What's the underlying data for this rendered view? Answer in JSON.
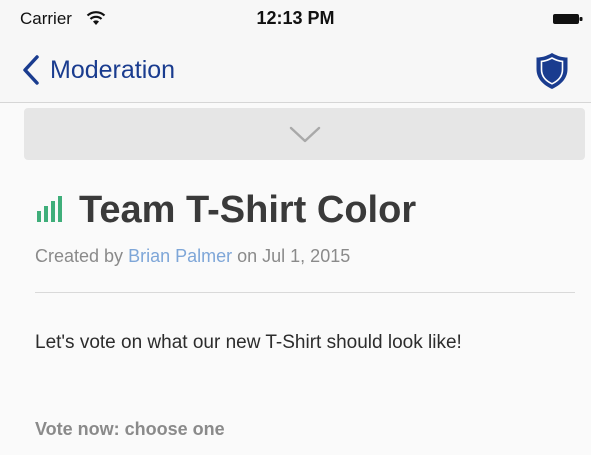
{
  "status_bar": {
    "carrier": "Carrier",
    "time": "12:13 PM",
    "wifi_icon": "wifi-icon",
    "battery_icon": "battery-icon"
  },
  "nav": {
    "back_label": "Moderation",
    "back_icon": "chevron-left-icon",
    "right_icon": "shield-icon",
    "accent_color": "#1a3c8f"
  },
  "poll": {
    "collapse_icon": "chevron-down-icon",
    "status_icon": "signal-bars-icon",
    "status_color": "#3fae7a",
    "title": "Team T-Shirt Color",
    "created_prefix": "Created by",
    "author": "Brian Palmer",
    "created_on": "on Jul 1, 2015",
    "description": "Let's vote on what our new T-Shirt should look like!",
    "vote_prompt": "Vote now: choose one"
  }
}
